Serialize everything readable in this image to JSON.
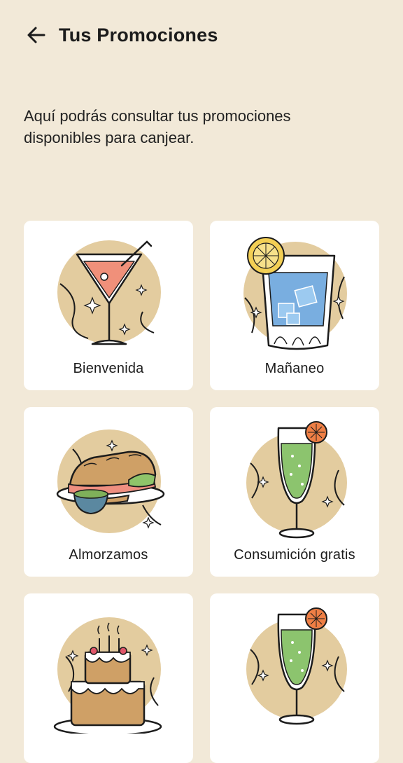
{
  "header": {
    "back_icon": "arrow-left-icon",
    "title": "Tus Promociones"
  },
  "intro": "Aquí podrás consultar tus promociones disponibles para canjear.",
  "promotions": [
    {
      "label": "Bienvenida",
      "icon": "cocktail-icon"
    },
    {
      "label": "Mañaneo",
      "icon": "water-glass-icon"
    },
    {
      "label": "Almorzamos",
      "icon": "sandwich-icon"
    },
    {
      "label": "Consumición gratis",
      "icon": "drink-glass-icon"
    },
    {
      "label": "",
      "icon": "cake-icon"
    },
    {
      "label": "",
      "icon": "drink-glass-icon"
    }
  ],
  "colors": {
    "background": "#f2e9d8",
    "card": "#ffffff",
    "illustration_circle": "#e3cc9f",
    "outline": "#1c1c1c"
  }
}
